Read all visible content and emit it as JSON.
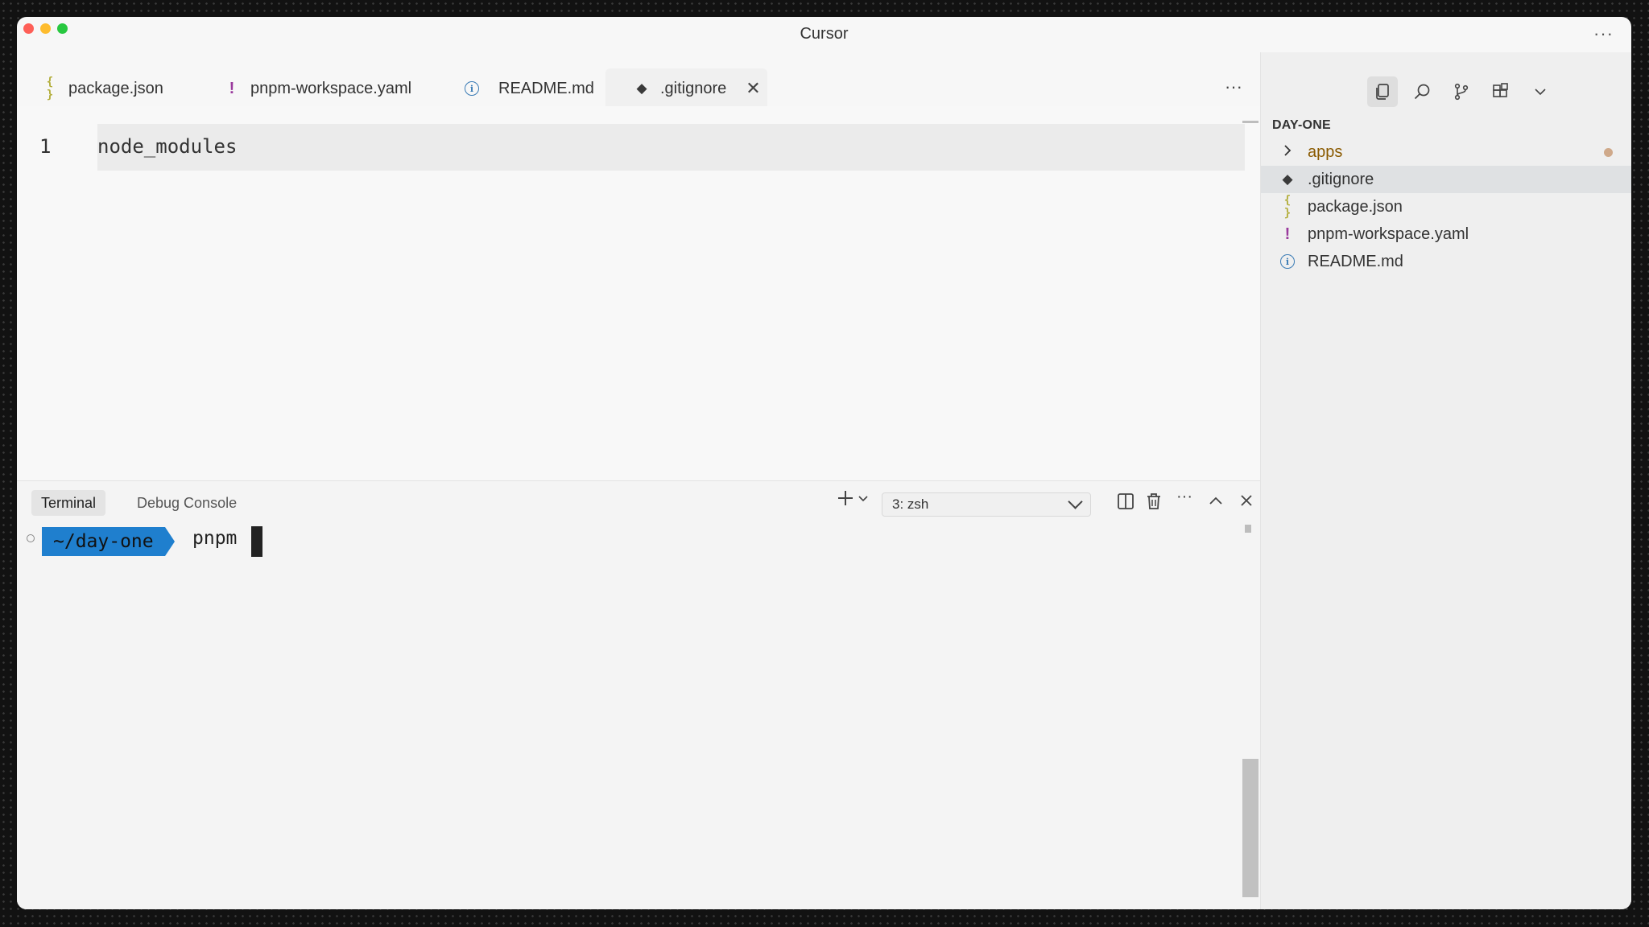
{
  "window": {
    "title": "Cursor"
  },
  "tabs": [
    {
      "label": "package.json",
      "icon": "json-icon",
      "active": false
    },
    {
      "label": "pnpm-workspace.yaml",
      "icon": "yaml-icon",
      "active": false
    },
    {
      "label": "README.md",
      "icon": "info-icon",
      "active": false
    },
    {
      "label": ".gitignore",
      "icon": "git-icon",
      "active": true
    }
  ],
  "editor": {
    "lines": [
      {
        "number": "1",
        "text": "node_modules"
      }
    ]
  },
  "panel": {
    "tabs": [
      {
        "label": "Terminal",
        "active": true
      },
      {
        "label": "Debug Console",
        "active": false
      }
    ],
    "terminal_selector": "3: zsh",
    "prompt_path": "~/day-one",
    "command": "pnpm"
  },
  "explorer": {
    "root": "DAY-ONE",
    "items": [
      {
        "label": "apps",
        "type": "folder",
        "modified": true,
        "color": "#8a5a00"
      },
      {
        "label": ".gitignore",
        "type": "git",
        "selected": true
      },
      {
        "label": "package.json",
        "type": "json"
      },
      {
        "label": "pnpm-workspace.yaml",
        "type": "yaml"
      },
      {
        "label": "README.md",
        "type": "info"
      }
    ]
  },
  "colors": {
    "prompt_bg": "#1f7fce",
    "folder_modified": "#cfa98a",
    "json_icon": "#b3ae3c",
    "yaml_icon": "#9a3a9d",
    "info_icon": "#3a7bb5"
  }
}
